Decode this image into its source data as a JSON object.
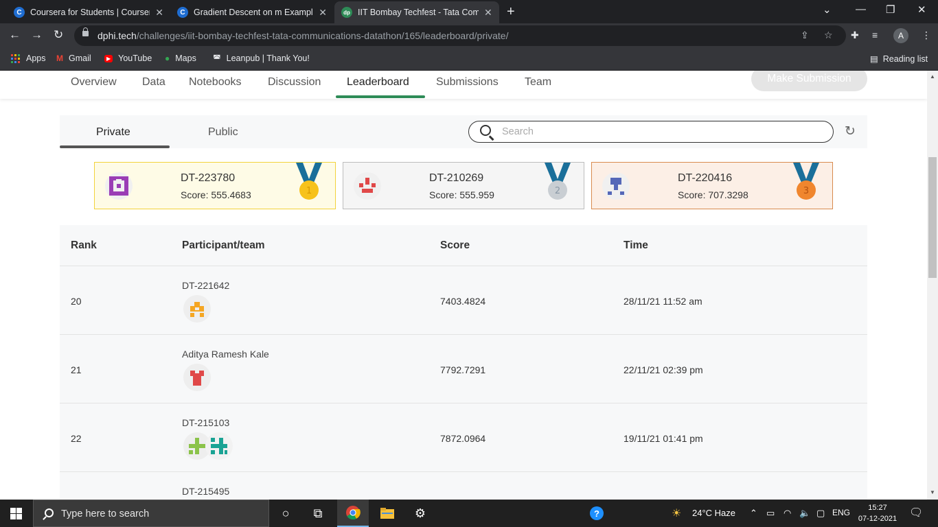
{
  "browser": {
    "tabs": [
      {
        "title": "Coursera for Students | Coursera",
        "favicon": "coursera-icon",
        "active": false
      },
      {
        "title": "Gradient Descent on m Examples",
        "favicon": "coursera-icon",
        "active": false
      },
      {
        "title": "IIT Bombay Techfest - Tata Comm",
        "favicon": "dphi-icon",
        "active": true
      }
    ],
    "new_tab": "+",
    "url_host": "dphi.tech",
    "url_path": "/challenges/iit-bombay-techfest-tata-communications-datathon/165/leaderboard/private/",
    "profile_initial": "A",
    "bookmarks": [
      {
        "label": "Apps",
        "icon": "apps-grid-icon"
      },
      {
        "label": "Gmail",
        "icon": "gmail-icon"
      },
      {
        "label": "YouTube",
        "icon": "youtube-icon"
      },
      {
        "label": "Maps",
        "icon": "maps-icon"
      },
      {
        "label": "Leanpub | Thank You!",
        "icon": "leanpub-icon"
      }
    ],
    "reading_list": "Reading list"
  },
  "nav": {
    "items": [
      "Overview",
      "Data",
      "Notebooks",
      "Discussion",
      "Leaderboard",
      "Submissions",
      "Team"
    ],
    "active": "Leaderboard",
    "make_submission": "Make Submission"
  },
  "leaderboard": {
    "tabs": [
      "Private",
      "Public"
    ],
    "active_tab": "Private",
    "search_placeholder": "Search",
    "top3": [
      {
        "name": "DT-223780",
        "score": "Score: 555.4683",
        "medal": "1",
        "bg": "#fefbe6",
        "border": "#f2d23a",
        "medal_color": "#f7c21b",
        "avatar_color": "#9a3db5"
      },
      {
        "name": "DT-210269",
        "score": "Score: 555.959",
        "medal": "2",
        "bg": "#f5f5f5",
        "border": "#bdbdbd",
        "medal_color": "#c9ced3",
        "avatar_color": "#e04848"
      },
      {
        "name": "DT-220416",
        "score": "Score: 707.3298",
        "medal": "3",
        "bg": "#fcefe6",
        "border": "#d88a4e",
        "medal_color": "#f0862e",
        "avatar_color": "#5568b8"
      }
    ],
    "columns": [
      "Rank",
      "Participant/team",
      "Score",
      "Time"
    ],
    "rows": [
      {
        "rank": "20",
        "name": "DT-221642",
        "score": "7403.4824",
        "time": "28/11/21 11:52 am"
      },
      {
        "rank": "21",
        "name": "Aditya Ramesh Kale",
        "score": "7792.7291",
        "time": "22/11/21 02:39 pm"
      },
      {
        "rank": "22",
        "name": "DT-215103",
        "score": "7872.0964",
        "time": "19/11/21 01:41 pm"
      },
      {
        "rank": "",
        "name": "DT-215495",
        "score": "",
        "time": ""
      }
    ]
  },
  "taskbar": {
    "search_placeholder": "Type here to search",
    "weather": "24°C  Haze",
    "language": "ENG",
    "time": "15:27",
    "date": "07-12-2021"
  }
}
